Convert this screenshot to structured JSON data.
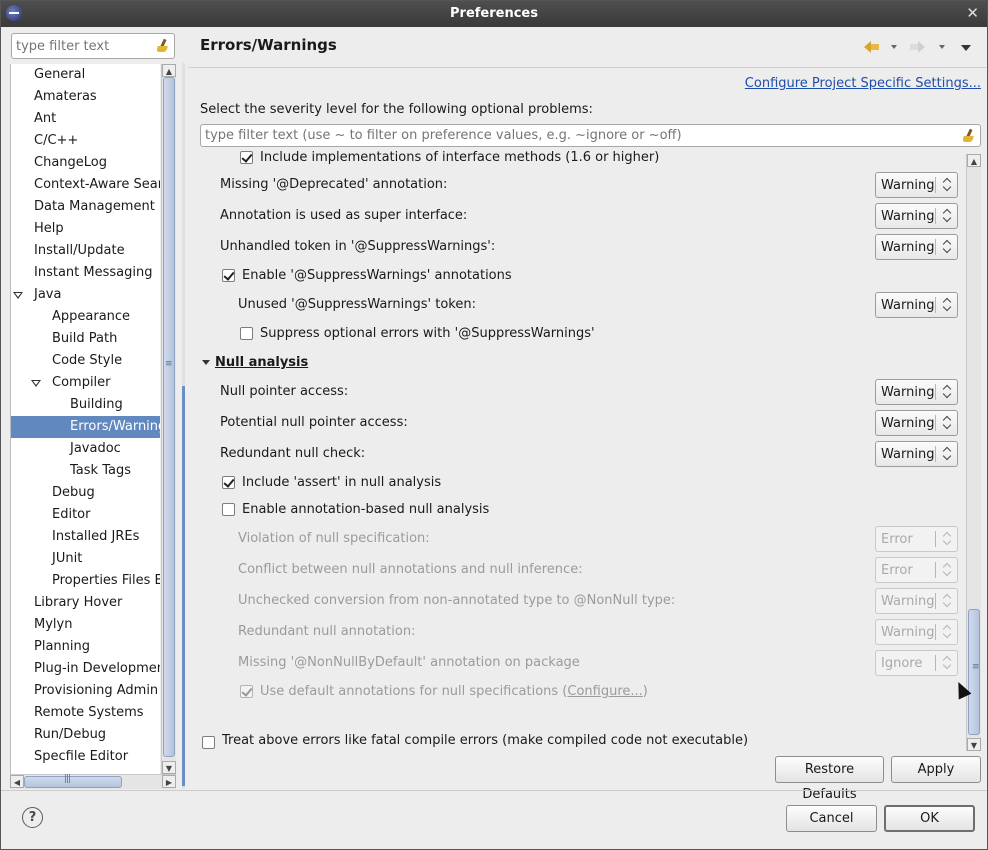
{
  "window": {
    "title": "Preferences"
  },
  "left": {
    "filter_placeholder": "type filter text",
    "tree": [
      {
        "label": "General",
        "indent": 0,
        "twisty": "closed"
      },
      {
        "label": "Amateras",
        "indent": 0,
        "twisty": "closed"
      },
      {
        "label": "Ant",
        "indent": 0,
        "twisty": "closed"
      },
      {
        "label": "C/C++",
        "indent": 0,
        "twisty": "closed"
      },
      {
        "label": "ChangeLog",
        "indent": 0,
        "twisty": "none"
      },
      {
        "label": "Context-Aware Searc",
        "indent": 0,
        "twisty": "none"
      },
      {
        "label": "Data Management",
        "indent": 0,
        "twisty": "closed"
      },
      {
        "label": "Help",
        "indent": 0,
        "twisty": "closed"
      },
      {
        "label": "Install/Update",
        "indent": 0,
        "twisty": "closed"
      },
      {
        "label": "Instant Messaging",
        "indent": 0,
        "twisty": "none"
      },
      {
        "label": "Java",
        "indent": 0,
        "twisty": "open"
      },
      {
        "label": "Appearance",
        "indent": 1,
        "twisty": "closed"
      },
      {
        "label": "Build Path",
        "indent": 1,
        "twisty": "closed"
      },
      {
        "label": "Code Style",
        "indent": 1,
        "twisty": "closed"
      },
      {
        "label": "Compiler",
        "indent": 1,
        "twisty": "open"
      },
      {
        "label": "Building",
        "indent": 2,
        "twisty": "none"
      },
      {
        "label": "Errors/Warnings",
        "indent": 2,
        "twisty": "none",
        "selected": true
      },
      {
        "label": "Javadoc",
        "indent": 2,
        "twisty": "none"
      },
      {
        "label": "Task Tags",
        "indent": 2,
        "twisty": "none"
      },
      {
        "label": "Debug",
        "indent": 1,
        "twisty": "closed"
      },
      {
        "label": "Editor",
        "indent": 1,
        "twisty": "closed"
      },
      {
        "label": "Installed JREs",
        "indent": 1,
        "twisty": "closed"
      },
      {
        "label": "JUnit",
        "indent": 1,
        "twisty": "none"
      },
      {
        "label": "Properties Files Ed",
        "indent": 1,
        "twisty": "none"
      },
      {
        "label": "Library Hover",
        "indent": 0,
        "twisty": "closed"
      },
      {
        "label": "Mylyn",
        "indent": 0,
        "twisty": "closed"
      },
      {
        "label": "Planning",
        "indent": 0,
        "twisty": "none"
      },
      {
        "label": "Plug-in Development",
        "indent": 0,
        "twisty": "closed"
      },
      {
        "label": "Provisioning Admin",
        "indent": 0,
        "twisty": "none"
      },
      {
        "label": "Remote Systems",
        "indent": 0,
        "twisty": "closed"
      },
      {
        "label": "Run/Debug",
        "indent": 0,
        "twisty": "closed"
      },
      {
        "label": "Specfile Editor",
        "indent": 0,
        "twisty": "closed"
      }
    ]
  },
  "page": {
    "title": "Errors/Warnings",
    "configure_link": "Configure Project Specific Settings...",
    "intro": "Select the severity level for the following optional problems:",
    "filter_placeholder": "type filter text (use ~ to filter on preference values, e.g. ~ignore or ~off)",
    "rows": [
      {
        "kind": "check",
        "label": "Include implementations of interface methods (1.6 or higher)",
        "checked": true,
        "indent": 2,
        "clipped": true
      },
      {
        "kind": "combo",
        "label": "Missing '@Deprecated' annotation:",
        "value": "Warning",
        "indent": 1
      },
      {
        "kind": "combo",
        "label": "Annotation is used as super interface:",
        "value": "Warning",
        "indent": 1
      },
      {
        "kind": "combo",
        "label": "Unhandled token in '@SuppressWarnings':",
        "value": "Warning",
        "indent": 1
      },
      {
        "kind": "check",
        "label": "Enable '@SuppressWarnings' annotations",
        "checked": true,
        "indent": 1
      },
      {
        "kind": "combo",
        "label": "Unused '@SuppressWarnings' token:",
        "value": "Warning",
        "indent": 2
      },
      {
        "kind": "check",
        "label": "Suppress optional errors with '@SuppressWarnings'",
        "checked": false,
        "indent": 2
      },
      {
        "kind": "section",
        "label": "Null analysis"
      },
      {
        "kind": "combo",
        "label": "Null pointer access:",
        "value": "Warning",
        "indent": 1
      },
      {
        "kind": "combo",
        "label": "Potential null pointer access:",
        "value": "Warning",
        "indent": 1
      },
      {
        "kind": "combo",
        "label": "Redundant null check:",
        "value": "Warning",
        "indent": 1
      },
      {
        "kind": "check",
        "label": "Include 'assert' in null analysis",
        "checked": true,
        "indent": 1
      },
      {
        "kind": "check",
        "label": "Enable annotation-based null analysis",
        "checked": false,
        "indent": 1
      },
      {
        "kind": "combo",
        "label": "Violation of null specification:",
        "value": "Error",
        "indent": 2,
        "disabled": true
      },
      {
        "kind": "combo",
        "label": "Conflict between null annotations and null inference:",
        "value": "Error",
        "indent": 2,
        "disabled": true
      },
      {
        "kind": "combo",
        "label": "Unchecked conversion from non-annotated type to @NonNull type:",
        "value": "Warning",
        "indent": 2,
        "disabled": true
      },
      {
        "kind": "combo",
        "label": "Redundant null annotation:",
        "value": "Warning",
        "indent": 2,
        "disabled": true
      },
      {
        "kind": "combo",
        "label": "Missing '@NonNullByDefault' annotation on package",
        "value": "Ignore",
        "indent": 2,
        "disabled": true
      },
      {
        "kind": "check",
        "label": "Use default annotations for null specifications (",
        "link": "Configure...",
        "suffix": ")",
        "checked": true,
        "indent": 2,
        "disabled": true
      }
    ],
    "fatal_check": {
      "label": "Treat above errors like fatal compile errors (make compiled code not executable)",
      "checked": false
    },
    "restore_defaults": "Restore Defaults",
    "apply": "Apply"
  },
  "footer": {
    "cancel": "Cancel",
    "ok": "OK",
    "help_glyph": "?"
  }
}
